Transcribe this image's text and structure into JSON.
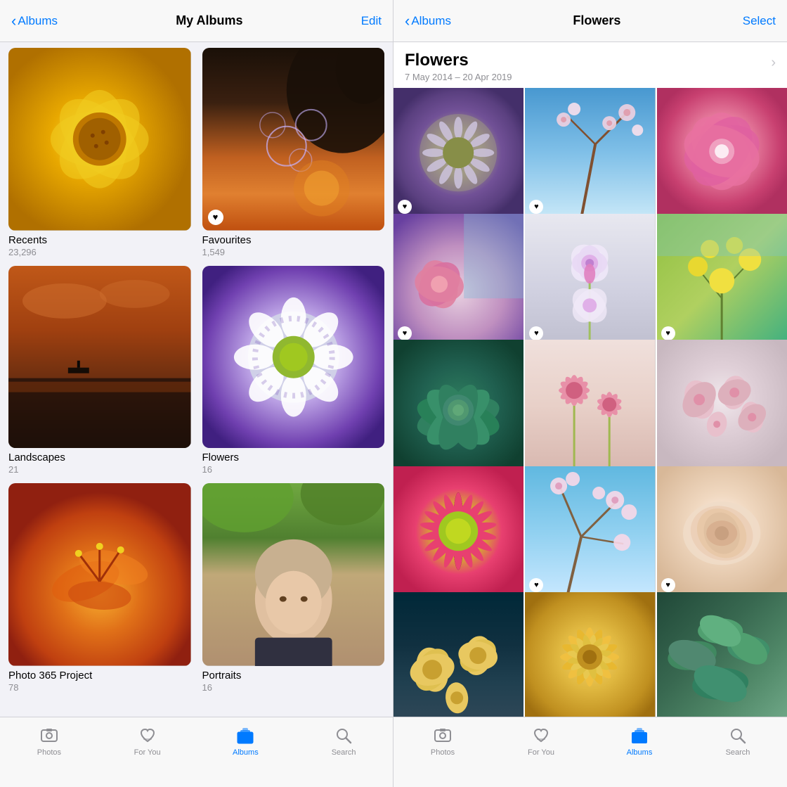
{
  "left": {
    "nav": {
      "back_label": "Albums",
      "title": "My Albums",
      "action_label": "Edit"
    },
    "albums": [
      {
        "id": "recents",
        "name": "Recents",
        "count": "23,296",
        "has_heart": false
      },
      {
        "id": "favourites",
        "name": "Favourites",
        "count": "1,549",
        "has_heart": true
      },
      {
        "id": "landscapes",
        "name": "Landscapes",
        "count": "21",
        "has_heart": false
      },
      {
        "id": "flowers",
        "name": "Flowers",
        "count": "16",
        "has_heart": false
      },
      {
        "id": "photo365",
        "name": "Photo 365 Project",
        "count": "78",
        "has_heart": false
      },
      {
        "id": "portraits",
        "name": "Portraits",
        "count": "16",
        "has_heart": false
      }
    ],
    "tabs": [
      {
        "id": "photos",
        "label": "Photos",
        "active": false
      },
      {
        "id": "for-you",
        "label": "For You",
        "active": false
      },
      {
        "id": "albums",
        "label": "Albums",
        "active": true
      },
      {
        "id": "search",
        "label": "Search",
        "active": false
      }
    ]
  },
  "right": {
    "nav": {
      "back_label": "Albums",
      "title": "Flowers",
      "action_label": "Select"
    },
    "header": {
      "title": "Flowers",
      "date_range": "7 May 2014 – 20 Apr 2019"
    },
    "photos": [
      {
        "id": "rf1",
        "has_heart": true
      },
      {
        "id": "rf2",
        "has_heart": true
      },
      {
        "id": "rf3",
        "has_heart": false
      },
      {
        "id": "rf4",
        "has_heart": true
      },
      {
        "id": "rf5",
        "has_heart": true
      },
      {
        "id": "rf6",
        "has_heart": true
      },
      {
        "id": "rf7",
        "has_heart": false
      },
      {
        "id": "rf8",
        "has_heart": false
      },
      {
        "id": "rf9",
        "has_heart": false
      },
      {
        "id": "rf10",
        "has_heart": false
      },
      {
        "id": "rf11",
        "has_heart": true
      },
      {
        "id": "rf12",
        "has_heart": true
      },
      {
        "id": "rf13",
        "has_heart": false
      },
      {
        "id": "rf14",
        "has_heart": false
      },
      {
        "id": "rf15",
        "has_heart": false
      }
    ],
    "tabs": [
      {
        "id": "photos",
        "label": "Photos",
        "active": false
      },
      {
        "id": "for-you",
        "label": "For You",
        "active": false
      },
      {
        "id": "albums",
        "label": "Albums",
        "active": true
      },
      {
        "id": "search",
        "label": "Search",
        "active": false
      }
    ]
  }
}
